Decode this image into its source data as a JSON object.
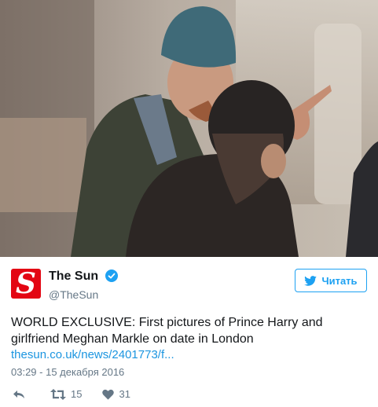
{
  "media": {
    "alt": "photo"
  },
  "author": {
    "display_name": "The Sun",
    "handle": "@TheSun",
    "logo_letter": "S",
    "brand_color": "#e30613",
    "verified": true
  },
  "follow_button": {
    "label": "Читать",
    "icon": "twitter-bird-icon",
    "color": "#1da1f2"
  },
  "tweet": {
    "text": "WORLD EXCLUSIVE: First pictures of Prince Harry and girlfriend Meghan Markle on date in London",
    "link": "thesun.co.uk/news/2401773/f...",
    "timestamp": "03:29 - 15 декабря 2016"
  },
  "actions": {
    "reply_icon": "reply-icon",
    "retweet_icon": "retweet-icon",
    "retweet_count": "15",
    "like_icon": "heart-icon",
    "like_count": "31"
  }
}
